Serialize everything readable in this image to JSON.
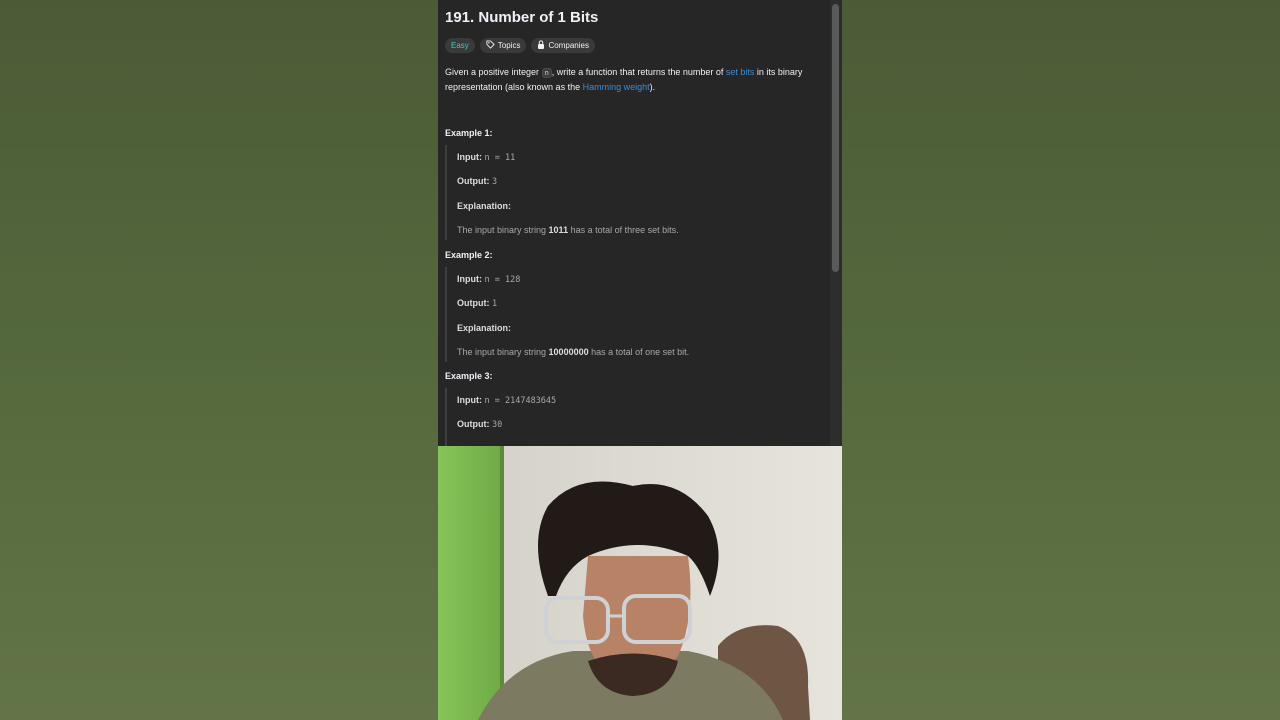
{
  "problem": {
    "title": "191. Number of 1 Bits",
    "tags": [
      {
        "label": "Easy",
        "icon": ""
      },
      {
        "label": "Topics",
        "icon": "tag-icon"
      },
      {
        "label": "Companies",
        "icon": "lock-icon"
      }
    ],
    "description": {
      "p1": "Given a positive integer ",
      "code": "n",
      "p2": ", write a function that returns the number of ",
      "link1": "set bits",
      "p3": " in its binary representation (also known as the ",
      "link2": "Hamming weight",
      "p4": ")."
    },
    "examples": [
      {
        "heading": "Example 1:",
        "input_label": "Input:",
        "input_value": "n = 11",
        "output_label": "Output:",
        "output_value": "3",
        "explanation_label": "Explanation:",
        "explanation_pre": "The input binary string ",
        "explanation_bold": "1011",
        "explanation_post": " has a total of three set bits."
      },
      {
        "heading": "Example 2:",
        "input_label": "Input:",
        "input_value": "n = 128",
        "output_label": "Output:",
        "output_value": "1",
        "explanation_label": "Explanation:",
        "explanation_pre": "The input binary string ",
        "explanation_bold": "10000000",
        "explanation_post": " has a total of one set bit."
      },
      {
        "heading": "Example 3:",
        "input_label": "Input:",
        "input_value": "n = 2147483645",
        "output_label": "Output:",
        "output_value": "30"
      }
    ]
  },
  "colors": {
    "panel_bg": "#262626",
    "easy": "#46c6c2",
    "link": "#3b8bd9",
    "background": "#4b5b36"
  }
}
